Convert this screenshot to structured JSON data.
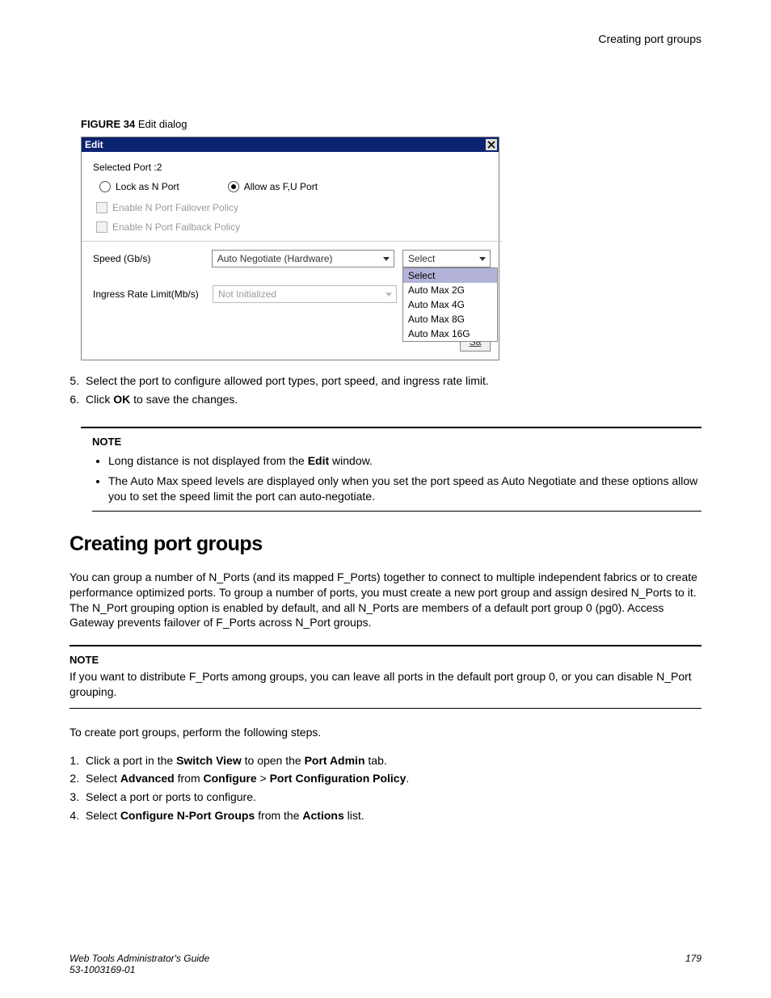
{
  "header": {
    "section_title": "Creating port groups"
  },
  "figure": {
    "label": "FIGURE 34",
    "caption": "Edit dialog",
    "dialog": {
      "title": "Edit",
      "selected_port_label": "Selected Port :2",
      "radio_lock": "Lock as N Port",
      "radio_allow": "Allow as F,U Port",
      "cb_failover": "Enable N Port Failover Policy",
      "cb_failback": "Enable N Port Failback Policy",
      "speed_label": "Speed (Gb/s)",
      "speed_value": "Auto Negotiate (Hardware)",
      "ingress_label": "Ingress Rate Limit(Mb/s)",
      "ingress_value": "Not Initialized",
      "select_display": "Select",
      "dropdown_options": {
        "o0": "Select",
        "o1": "Auto Max 2G",
        "o2": "Auto Max 4G",
        "o3": "Auto Max 8G",
        "o4": "Auto Max 16G"
      },
      "save_label": "Sa"
    }
  },
  "steps_after_figure": {
    "s5": "Select the port to configure allowed port types, port speed, and ingress rate limit.",
    "s6_prefix": "Click ",
    "s6_bold": "OK",
    "s6_suffix": " to save the changes."
  },
  "note1": {
    "title": "NOTE",
    "b1_prefix": "Long distance is not displayed from the ",
    "b1_bold": "Edit",
    "b1_suffix": " window.",
    "b2": "The Auto Max speed levels are displayed only when you set the port speed as Auto Negotiate and these options allow you to set the speed limit the port can auto-negotiate."
  },
  "section": {
    "heading": "Creating port groups",
    "intro": "You can group a number of N_Ports (and its mapped F_Ports) together to connect to multiple independent fabrics or to create performance optimized ports. To group a number of ports, you must create a new port group and assign desired N_Ports to it. The N_Port grouping option is enabled by default, and all N_Ports are members of a default port group 0 (pg0). Access Gateway prevents failover of F_Ports across N_Port groups.",
    "note2_title": "NOTE",
    "note2_body": "If you want to distribute F_Ports among groups, you can leave all ports in the default port group 0, or you can disable N_Port grouping.",
    "steps_intro": "To create port groups, perform the following steps.",
    "step1_a": "Click a port in the ",
    "step1_b": "Switch View",
    "step1_c": " to open the ",
    "step1_d": "Port Admin",
    "step1_e": " tab.",
    "step2_a": "Select ",
    "step2_b": "Advanced",
    "step2_c": " from ",
    "step2_d": "Configure",
    "step2_e": "  > ",
    "step2_f": "Port Configuration Policy",
    "step2_g": ".",
    "step3": "Select a port or ports to configure.",
    "step4_a": "Select ",
    "step4_b": "Configure N-Port Groups",
    "step4_c": " from the ",
    "step4_d": "Actions",
    "step4_e": " list."
  },
  "footer": {
    "left1": "Web Tools Administrator's Guide",
    "left2": "53-1003169-01",
    "right": "179"
  }
}
